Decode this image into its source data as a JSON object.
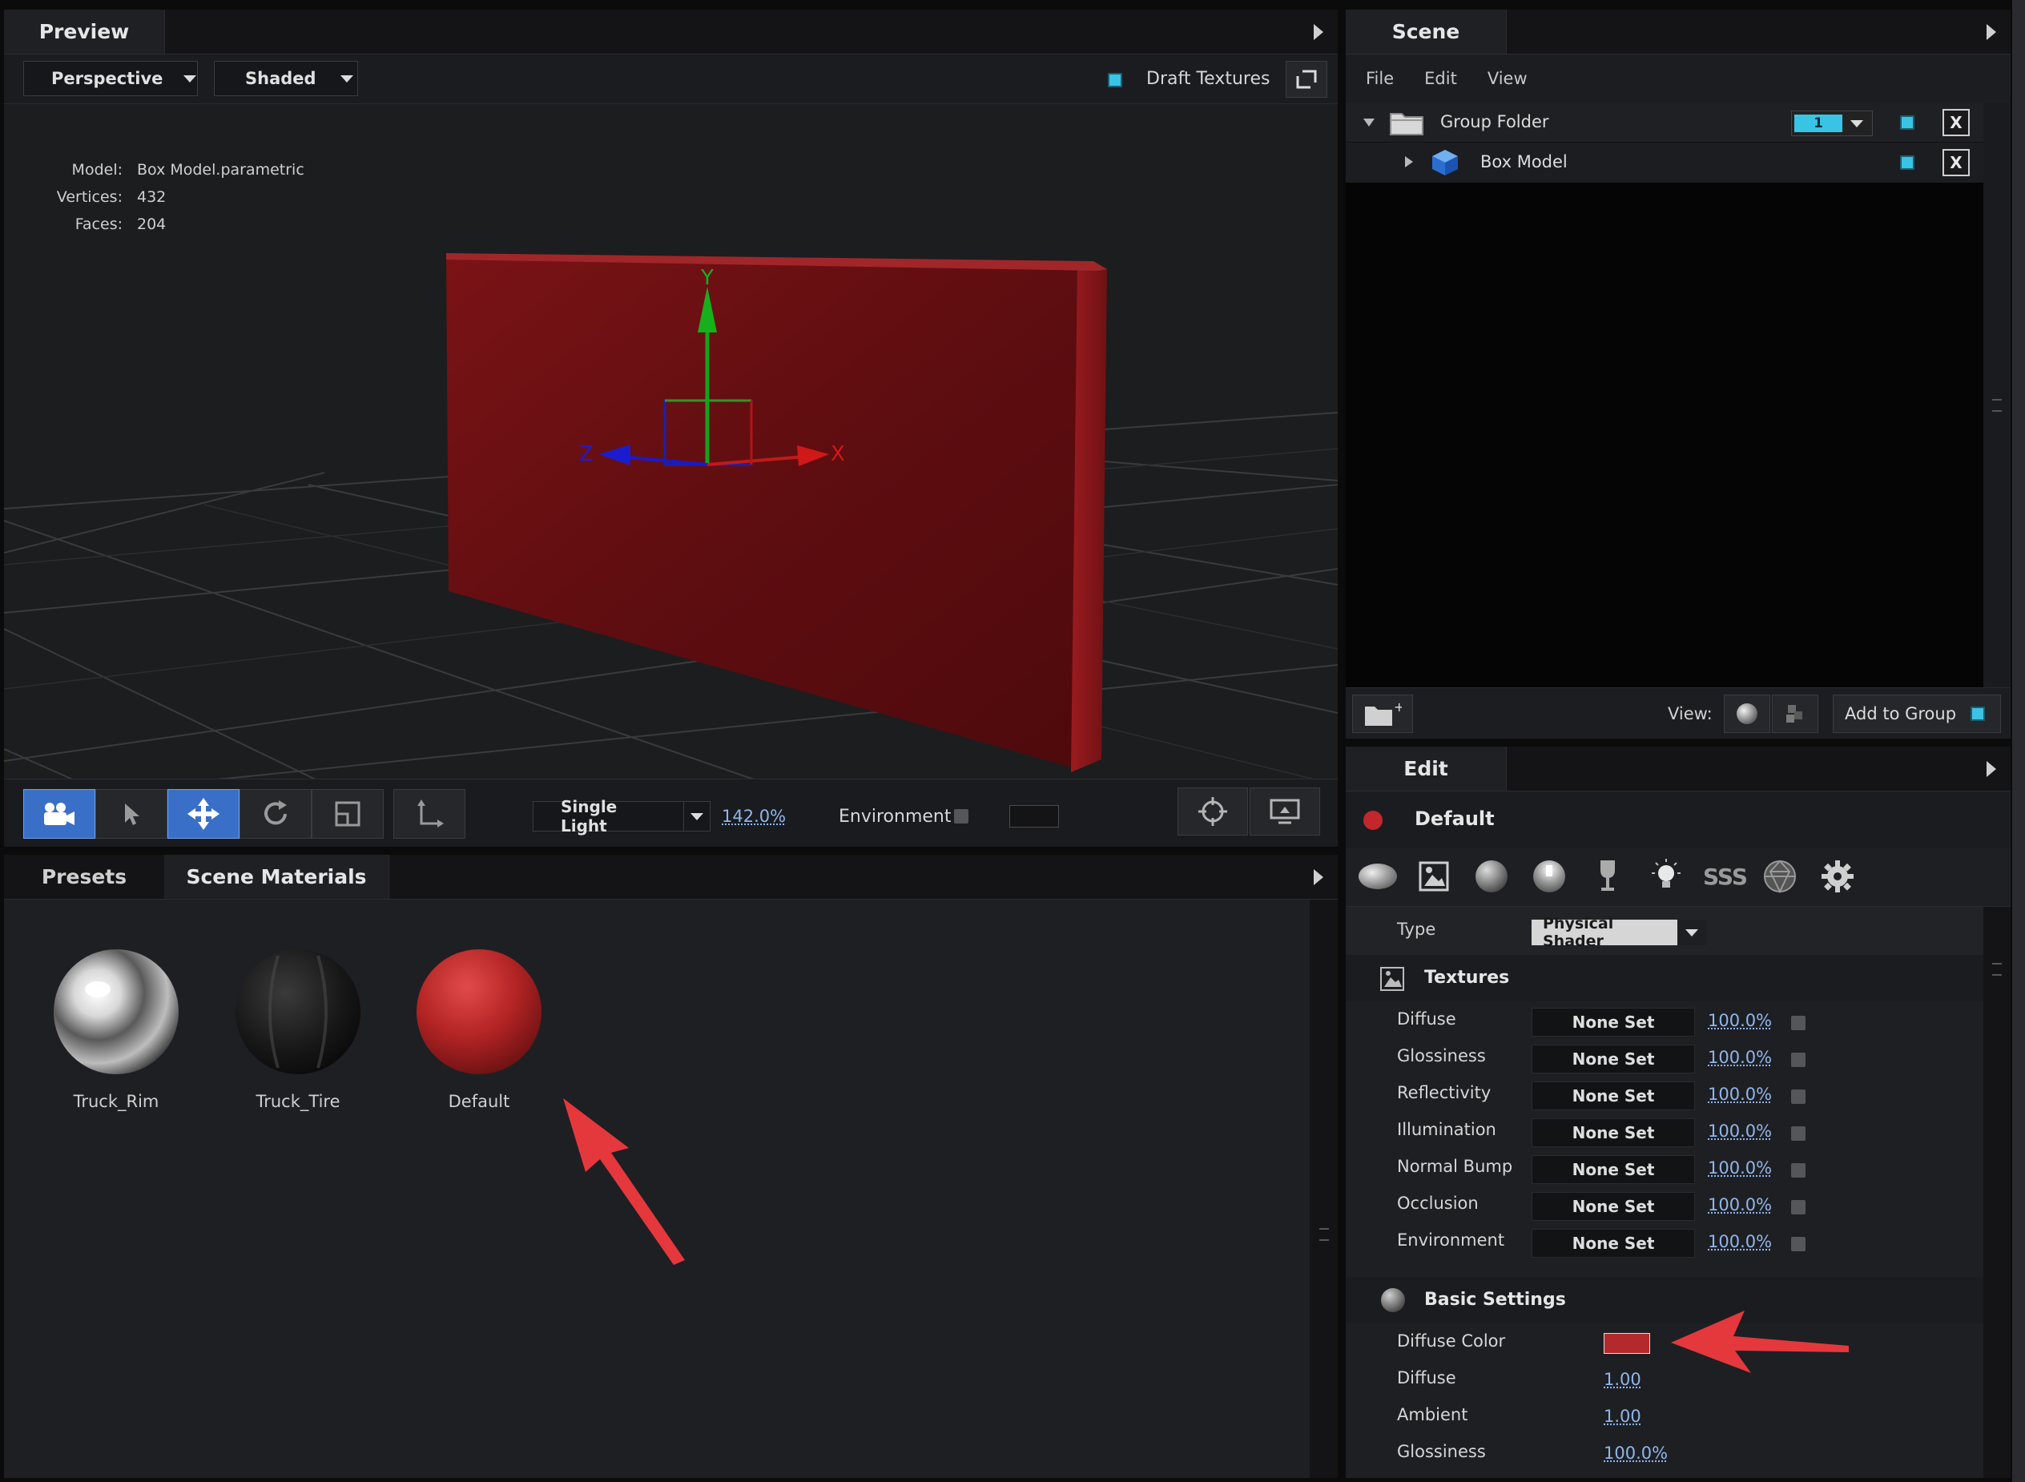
{
  "preview": {
    "tab": "Preview",
    "projection": "Perspective",
    "shading": "Shaded",
    "draft_textures_label": "Draft Textures",
    "info": [
      {
        "key": "Model:",
        "value": "Box Model.parametric"
      },
      {
        "key": "Vertices:",
        "value": "432"
      },
      {
        "key": "Faces:",
        "value": "204"
      }
    ],
    "axes": {
      "x": "X",
      "y": "Y",
      "z": "Z"
    },
    "object_color": "#8a1518"
  },
  "viewport_toolbar": {
    "light_mode": "Single Light",
    "zoom": "142.0%",
    "environment_label": "Environment"
  },
  "materials": {
    "tabs": [
      "Presets",
      "Scene Materials"
    ],
    "items": [
      {
        "name": "Truck_Rim"
      },
      {
        "name": "Truck_Tire"
      },
      {
        "name": "Default"
      }
    ]
  },
  "scene": {
    "tab": "Scene",
    "menu": [
      "File",
      "Edit",
      "View"
    ],
    "tree": [
      {
        "label": "Group Folder",
        "badge": "1"
      },
      {
        "label": "Box Model"
      }
    ],
    "view_label": "View:",
    "add_to_group": "Add to Group"
  },
  "edit": {
    "tab": "Edit",
    "material_name": "Default",
    "type_label": "Type",
    "type_value": "Physical Shader",
    "textures_header": "Textures",
    "textures": [
      {
        "label": "Diffuse",
        "value": "None Set",
        "amount": "100.0%"
      },
      {
        "label": "Glossiness",
        "value": "None Set",
        "amount": "100.0%"
      },
      {
        "label": "Reflectivity",
        "value": "None Set",
        "amount": "100.0%"
      },
      {
        "label": "Illumination",
        "value": "None Set",
        "amount": "100.0%"
      },
      {
        "label": "Normal Bump",
        "value": "None Set",
        "amount": "100.0%"
      },
      {
        "label": "Occlusion",
        "value": "None Set",
        "amount": "100.0%"
      },
      {
        "label": "Environment",
        "value": "None Set",
        "amount": "100.0%"
      }
    ],
    "basic_header": "Basic Settings",
    "diffuse_color_label": "Diffuse Color",
    "diffuse_color": "#b42a2c",
    "basic": [
      {
        "label": "Diffuse",
        "value": "1.00"
      },
      {
        "label": "Ambient",
        "value": "1.00"
      },
      {
        "label": "Glossiness",
        "value": "100.0%"
      }
    ]
  },
  "colors": {
    "accent_checkbox": "#39c4e6",
    "annotation_arrow": "#e5383c",
    "selected_tool": "#3a6fc8"
  }
}
